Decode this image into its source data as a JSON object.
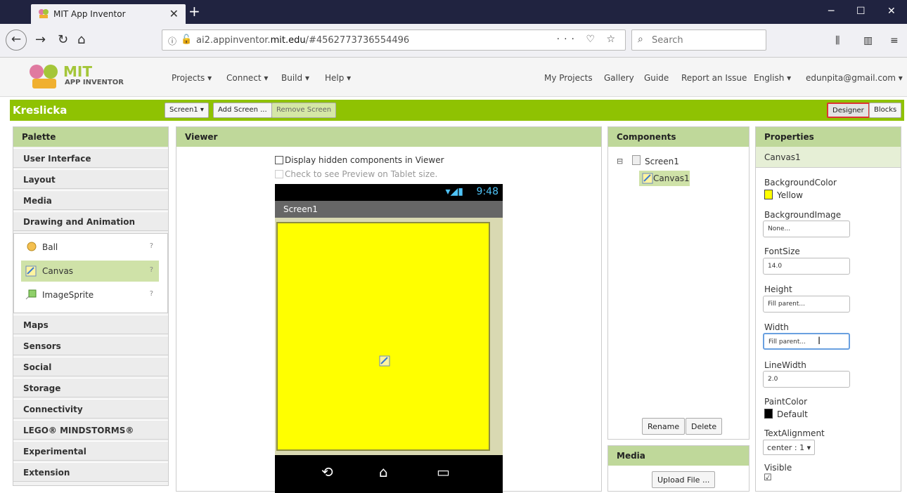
{
  "browser": {
    "tab_title": "MIT App Inventor",
    "url_prefix": "ai2.appinventor.",
    "url_domain": "mit.edu",
    "url_rest": "/#4562773736554496",
    "search_placeholder": "Search"
  },
  "header": {
    "brand": "MIT",
    "brand_sub": "APP INVENTOR",
    "menus": [
      "Projects ▾",
      "Connect ▾",
      "Build ▾",
      "Help ▾"
    ],
    "right_links": [
      "My Projects",
      "Gallery",
      "Guide",
      "Report an Issue",
      "English ▾",
      "edunpita@gmail.com ▾"
    ]
  },
  "project": {
    "name": "Kreslicka",
    "screen_select": "Screen1 ▾",
    "add_screen": "Add Screen ...",
    "remove_screen": "Remove Screen",
    "designer": "Designer",
    "blocks": "Blocks"
  },
  "palette": {
    "title": "Palette",
    "categories_top": [
      "User Interface",
      "Layout",
      "Media",
      "Drawing and Animation"
    ],
    "items": [
      {
        "label": "Ball"
      },
      {
        "label": "Canvas"
      },
      {
        "label": "ImageSprite"
      }
    ],
    "categories_bottom": [
      "Maps",
      "Sensors",
      "Social",
      "Storage",
      "Connectivity",
      "LEGO® MINDSTORMS®",
      "Experimental",
      "Extension"
    ],
    "help": "?"
  },
  "viewer": {
    "title": "Viewer",
    "show_hidden": "Display hidden components in Viewer",
    "tablet_preview": "Check to see Preview on Tablet size.",
    "time": "9:48",
    "screen_title": "Screen1"
  },
  "components": {
    "title": "Components",
    "root": "Screen1",
    "child": "Canvas1",
    "rename": "Rename",
    "delete": "Delete"
  },
  "media": {
    "title": "Media",
    "upload": "Upload File ..."
  },
  "properties": {
    "title": "Properties",
    "component": "Canvas1",
    "bg_color_label": "BackgroundColor",
    "bg_color_value": "Yellow",
    "bg_color_hex": "#ffff00",
    "bg_image_label": "BackgroundImage",
    "bg_image_value": "None...",
    "font_size_label": "FontSize",
    "font_size_value": "14.0",
    "height_label": "Height",
    "height_value": "Fill parent...",
    "width_label": "Width",
    "width_value": "Fill parent...",
    "line_width_label": "LineWidth",
    "line_width_value": "2.0",
    "paint_color_label": "PaintColor",
    "paint_color_value": "Default",
    "paint_color_hex": "#000000",
    "text_align_label": "TextAlignment",
    "text_align_value": "center : 1 ▾",
    "visible_label": "Visible",
    "visible_value": "☑"
  },
  "colors": {
    "accent_green": "#8fc202",
    "panel_header": "#bfd89a",
    "selection": "#cfe2a8"
  }
}
